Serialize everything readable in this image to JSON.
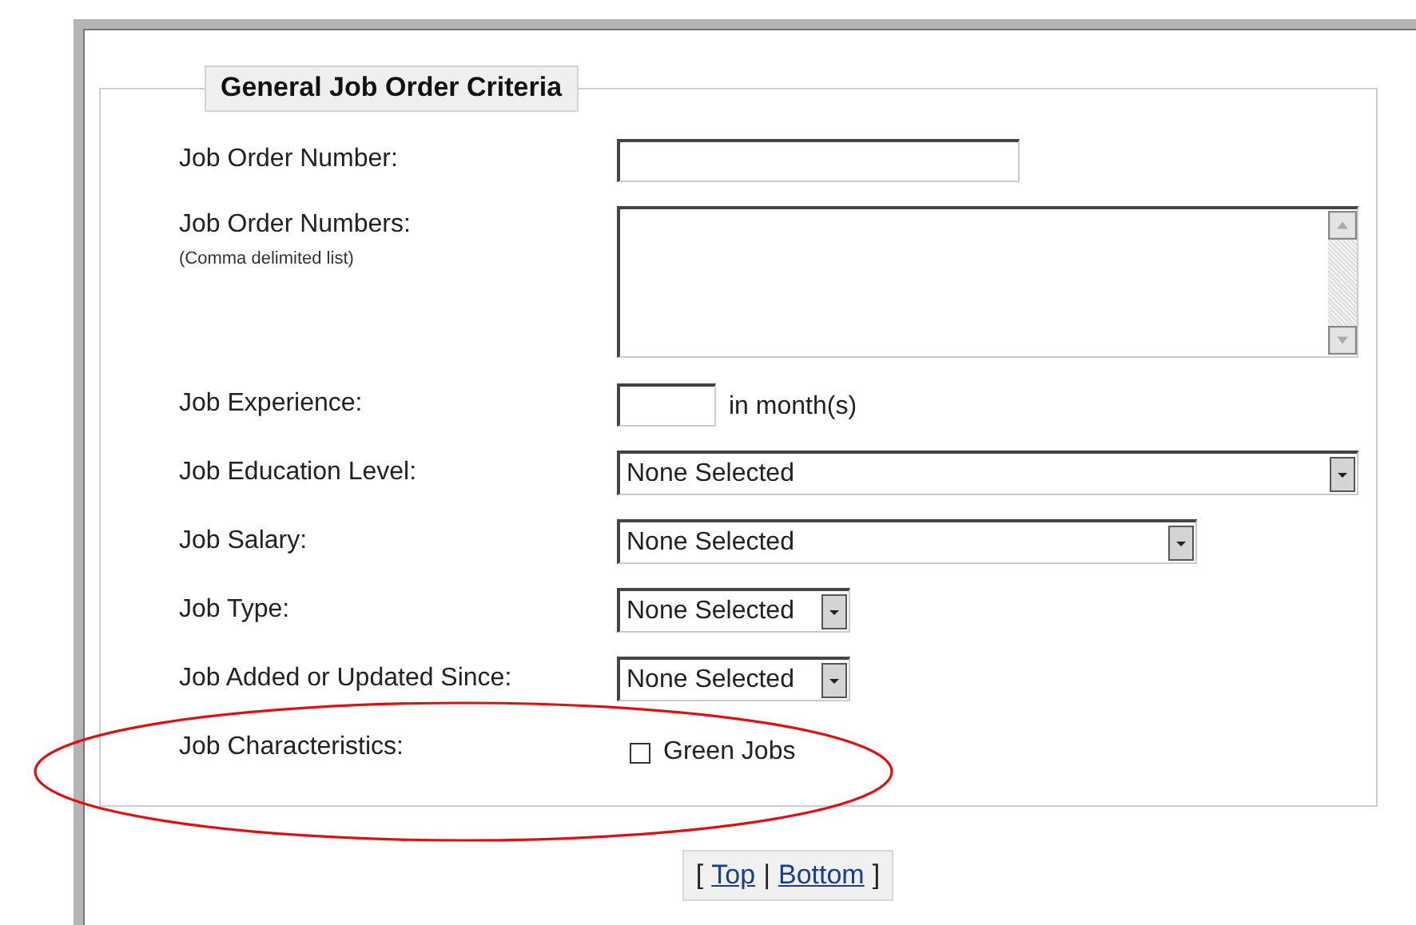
{
  "section": {
    "title": "General Job Order Criteria"
  },
  "fields": [
    {
      "kind": "text",
      "label": "Job Order Number:"
    },
    {
      "kind": "textarea",
      "label": "Job Order Numbers:",
      "hint": "(Comma delimited list)"
    },
    {
      "kind": "text",
      "label": "Job Experience:",
      "suffix": "in month(s)"
    },
    {
      "kind": "select",
      "label": "Job Education Level:",
      "value": "None Selected"
    },
    {
      "kind": "select",
      "label": "Job Salary:",
      "value": "None Selected"
    },
    {
      "kind": "select",
      "label": "Job Type:",
      "value": "None Selected"
    },
    {
      "kind": "select",
      "label": "Job Added or Updated Since:",
      "value": "None Selected"
    },
    {
      "kind": "checkbox",
      "label": "Job Characteristics:",
      "option": "Green Jobs",
      "checked": false
    }
  ],
  "nav": {
    "open": "[",
    "links": [
      "Top",
      "Bottom"
    ],
    "separator": "|",
    "close": "]"
  }
}
